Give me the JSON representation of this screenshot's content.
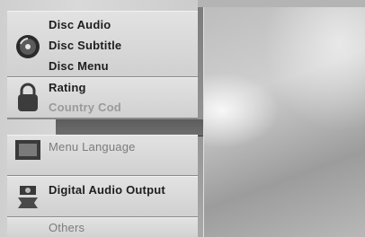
{
  "menu": {
    "disc_audio": "Disc Audio",
    "disc_subtitle": "Disc Subtitle",
    "disc_menu": "Disc Menu",
    "rating": "Rating",
    "country_code": "Country Cod",
    "menu_language": "Menu Language",
    "digital_audio_output": "Digital Audio Output",
    "others": "Others"
  },
  "icons": {
    "disc": "disc-icon",
    "lock": "lock-icon",
    "screen": "screen-icon",
    "audio": "audio-output-icon"
  }
}
